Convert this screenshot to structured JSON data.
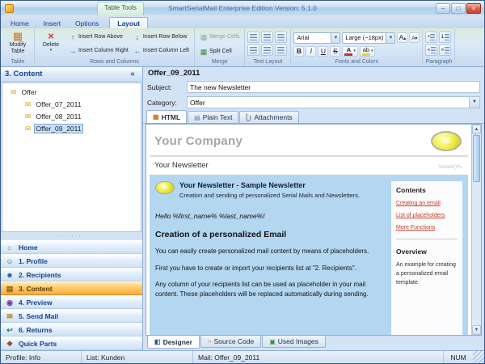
{
  "window": {
    "title": "SmartSerialMail Enterprise Edition Version: 5.1.0",
    "context_tab_group": "Table Tools"
  },
  "ribbon": {
    "tabs": [
      "Home",
      "Insert",
      "Options",
      "Layout"
    ],
    "table": {
      "label": "Table",
      "modify_table": "Modify Table"
    },
    "rows_columns": {
      "label": "Rows and Columns",
      "delete": "Delete",
      "insert_row_above": "Insert Row Above",
      "insert_row_below": "Insert Row Below",
      "insert_column_right": "Insert Column Right",
      "insert_column_left": "Insert Column Left"
    },
    "merge": {
      "label": "Merge",
      "merge_cells": "Merge Cells",
      "split_cell": "Split Cell"
    },
    "text_layout": {
      "label": "Text Layout"
    },
    "fonts_colors": {
      "label": "Fonts and Colors",
      "font_name": "Arial",
      "font_size": "Large (~18px)",
      "bold": "B",
      "italic": "I",
      "underline": "U",
      "strike": "S",
      "grow": "A",
      "shrink": "A",
      "color": "A",
      "highlight": "ab"
    },
    "paragraph": {
      "label": "Paragraph"
    }
  },
  "sidebar": {
    "title": "3. Content",
    "collapse": "«",
    "tree": {
      "root": "Offer",
      "items": [
        "Offer_07_2011",
        "Offer_08_2011",
        "Offer_09_2011"
      ]
    },
    "nav": [
      "Home",
      "1. Profile",
      "2. Recipients",
      "3. Content",
      "4. Preview",
      "5. Send Mail",
      "6. Returns",
      "Quick Parts"
    ]
  },
  "editor": {
    "mail_name": "Offer_09_2011",
    "subject_label": "Subject:",
    "subject_value": "The new Newsletter",
    "category_label": "Category:",
    "category_value": "Offer",
    "tabs": [
      "HTML",
      "Plain Text",
      "Attachments"
    ],
    "bottom_tabs": [
      "Designer",
      "Source Code",
      "Used Images"
    ]
  },
  "preview": {
    "company": "Your Company",
    "newsletter": "Your Newsletter",
    "date_placeholder": "%date()%",
    "banner_title": "Your Newsletter - Sample Newsletter",
    "banner_subtitle": "Creation and sending of personalized Serial Mails and Newsletters.",
    "greeting": "Hello %first_name% %last_name%!",
    "heading": "Creation of a personalized Email",
    "paragraphs": [
      "You can easily create personalized mail content by means of placeholders.",
      "First you have to create or import your recipients list at \"2. Recipients\".",
      "Any column of your recipients list can be used as placeholder in your mail content. These placeholders will be replaced automatically during sending."
    ],
    "contents_title": "Contents",
    "contents_links": [
      "Creating an email",
      "List of placeholders",
      "More Functions"
    ],
    "overview_title": "Overview",
    "overview_text": "An example for creating a personalized email template."
  },
  "statusbar": {
    "profile": "Profile: Info",
    "list": "List: Kunden",
    "mail": "Mail: Offer_09_2011",
    "num": "NUM"
  },
  "colors": {
    "nav_active": "#ffab3c",
    "link": "#c3402b",
    "preview_blue": "#b3d6f1"
  }
}
